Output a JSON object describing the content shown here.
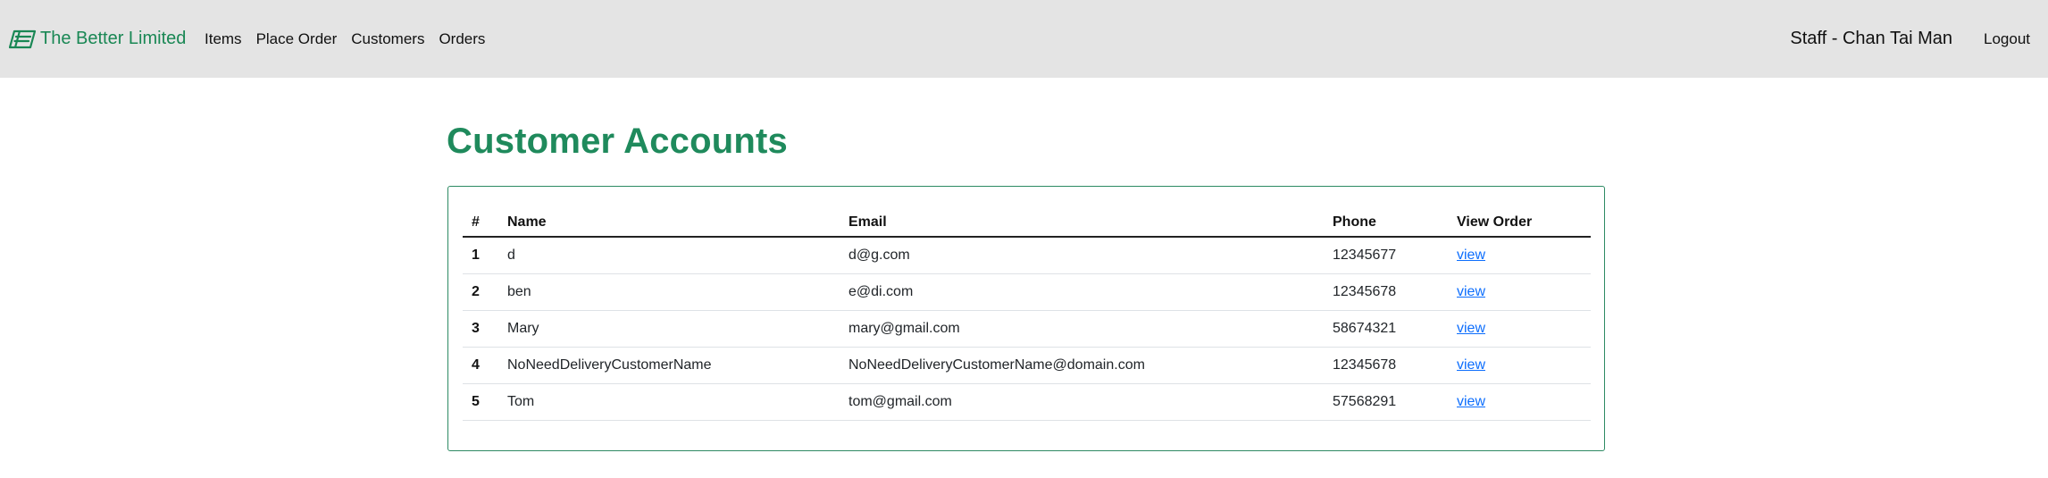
{
  "navbar": {
    "brand": "The Better Limited",
    "links": [
      "Items",
      "Place Order",
      "Customers",
      "Orders"
    ],
    "staff": "Staff - Chan Tai Man",
    "logout": "Logout"
  },
  "page": {
    "title": "Customer Accounts"
  },
  "table": {
    "headers": [
      "#",
      "Name",
      "Email",
      "Phone",
      "View Order"
    ],
    "rows": [
      {
        "num": "1",
        "name": "d",
        "email": "d@g.com",
        "phone": "12345677",
        "action": "view"
      },
      {
        "num": "2",
        "name": "ben",
        "email": "e@di.com",
        "phone": "12345678",
        "action": "view"
      },
      {
        "num": "3",
        "name": "Mary",
        "email": "mary@gmail.com",
        "phone": "58674321",
        "action": "view"
      },
      {
        "num": "4",
        "name": "NoNeedDeliveryCustomerName",
        "email": "NoNeedDeliveryCustomerName@domain.com",
        "phone": "12345678",
        "action": "view"
      },
      {
        "num": "5",
        "name": "Tom",
        "email": "tom@gmail.com",
        "phone": "57568291",
        "action": "view"
      }
    ]
  },
  "colors": {
    "brand": "#198754",
    "title": "#1f8a5c",
    "link": "#0d6efd",
    "navbar_bg": "#e4e4e4",
    "card_border": "#2d8a63"
  },
  "icons": {
    "brand_logo": "brand-logo-icon"
  }
}
